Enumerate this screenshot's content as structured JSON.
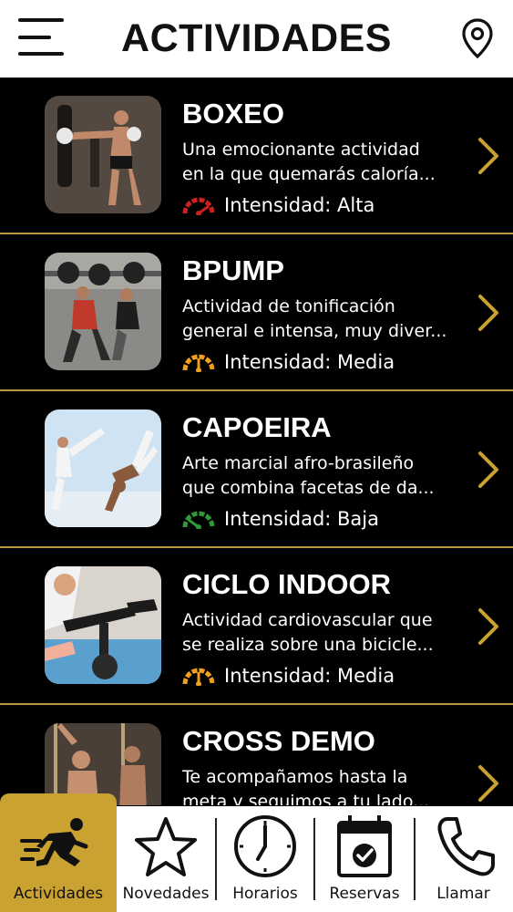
{
  "header": {
    "title": "ACTIVIDADES"
  },
  "activities": [
    {
      "title": "BOXEO",
      "desc1": "Una emocionante actividad",
      "desc2": "en la que quemarás caloría...",
      "intensity": "Intensidad: Alta",
      "level_color": "#d01f1f"
    },
    {
      "title": "BPUMP",
      "desc1": "Actividad de tonificación",
      "desc2": "general e intensa, muy diver...",
      "intensity": "Intensidad: Media",
      "level_color": "#f0a01c"
    },
    {
      "title": "CAPOEIRA",
      "desc1": "Arte marcial afro-brasileño",
      "desc2": "que combina facetas de da...",
      "intensity": "Intensidad: Baja",
      "level_color": "#2f9a3a"
    },
    {
      "title": "CICLO INDOOR",
      "desc1": "Actividad cardiovascular que",
      "desc2": "se realiza sobre una bicicle...",
      "intensity": "Intensidad: Media",
      "level_color": "#f0a01c"
    },
    {
      "title": "CROSS DEMO",
      "desc1": "Te acompañamos hasta la",
      "desc2": "meta y seguimos a tu lado...",
      "intensity": "",
      "level_color": ""
    }
  ],
  "nav": {
    "actividades": "Actividades",
    "novedades": "Novedades",
    "horarios": "Horarios",
    "reservas": "Reservas",
    "llamar": "Llamar"
  },
  "colors": {
    "accent": "#c9a232",
    "divider": "#b8993f",
    "chevron": "#c9a232"
  }
}
